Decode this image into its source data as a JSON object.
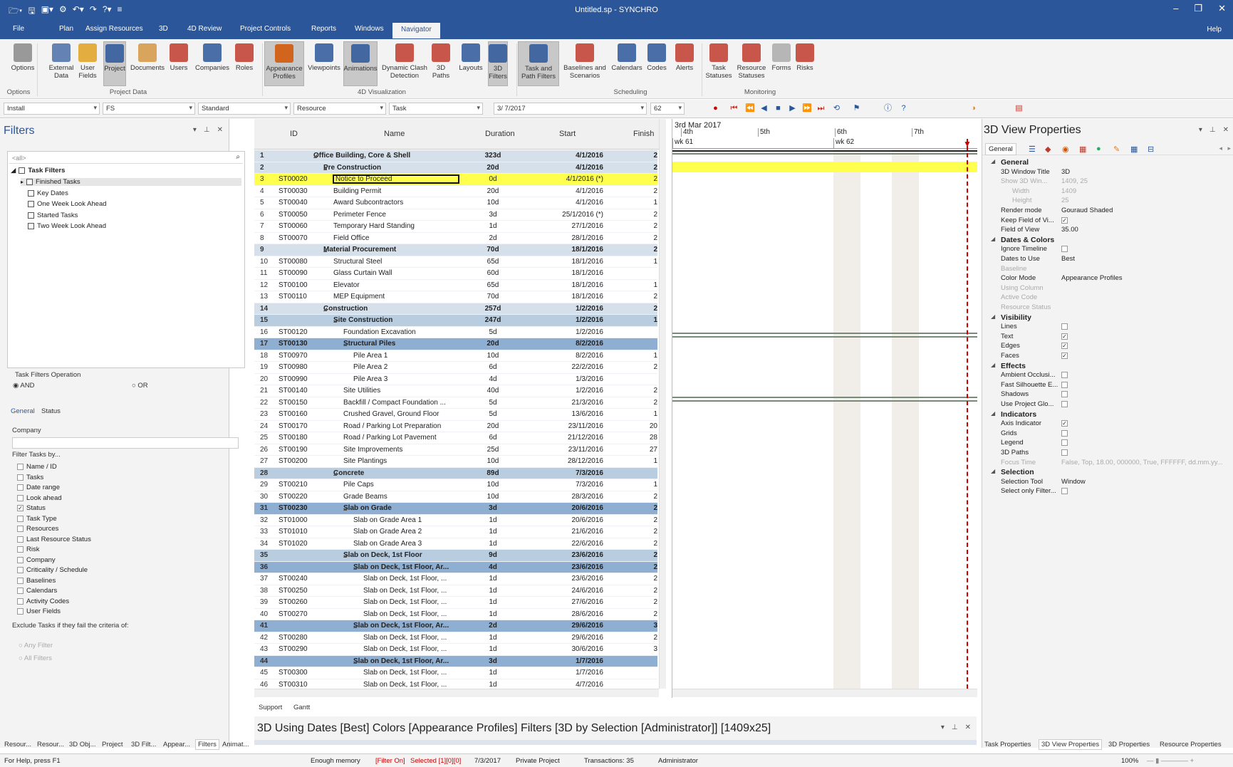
{
  "window": {
    "title": "Untitled.sp - SYNCHRO"
  },
  "tabs": [
    "File",
    "Plan",
    "Assign Resources",
    "3D",
    "4D Review",
    "Project Controls",
    "Reports",
    "Windows",
    "Navigator"
  ],
  "active_tab": "Navigator",
  "help": "Help",
  "ribbon": {
    "buttons": [
      {
        "label": "Options",
        "icon": "gear-icon"
      },
      {
        "label": "External Data",
        "icon": "network-icon"
      },
      {
        "label": "User Fields",
        "icon": "braces-icon"
      },
      {
        "label": "Project",
        "icon": "project-icon"
      },
      {
        "label": "Documents",
        "icon": "document-icon"
      },
      {
        "label": "Users",
        "icon": "user-icon"
      },
      {
        "label": "Companies",
        "icon": "building-icon"
      },
      {
        "label": "Roles",
        "icon": "role-icon"
      },
      {
        "label": "Appearance Profiles",
        "icon": "appearance-icon"
      },
      {
        "label": "Viewpoints",
        "icon": "viewpoint-icon"
      },
      {
        "label": "Animations",
        "icon": "film-icon"
      },
      {
        "label": "Dynamic Clash Detection",
        "icon": "clash-icon"
      },
      {
        "label": "3D Paths",
        "icon": "path-icon"
      },
      {
        "label": "Layouts",
        "icon": "layout-icon"
      },
      {
        "label": "3D Filters",
        "icon": "cube-filter-icon"
      },
      {
        "label": "Task and Path Filters",
        "icon": "funnel-icon"
      },
      {
        "label": "Baselines and Scenarios",
        "icon": "baseline-icon"
      },
      {
        "label": "Calendars",
        "icon": "calendar-icon"
      },
      {
        "label": "Codes",
        "icon": "codes-icon"
      },
      {
        "label": "Alerts",
        "icon": "alert-icon"
      },
      {
        "label": "Task Statuses",
        "icon": "task-status-icon"
      },
      {
        "label": "Resource Statuses",
        "icon": "resource-status-icon"
      },
      {
        "label": "Forms",
        "icon": "form-icon"
      },
      {
        "label": "Risks",
        "icon": "risk-icon"
      }
    ],
    "groups": [
      "Options",
      "Project Data",
      "4D Visualization",
      "Scheduling",
      "Monitoring"
    ]
  },
  "toolbar": {
    "combo1": "Install",
    "combo2": "FS",
    "combo3": "Standard",
    "combo4": "Resource",
    "combo5": "Task",
    "date": "3/ 7/2017",
    "zoom": "62"
  },
  "filters": {
    "title": "Filters",
    "search_placeholder": "<all>",
    "root": "Task Filters",
    "items": [
      "Finished Tasks",
      "Key Dates",
      "One Week Look Ahead",
      "Started Tasks",
      "Two Week Look Ahead"
    ],
    "operation_label": "Task Filters Operation",
    "op_and": "AND",
    "op_or": "OR",
    "subtabs": [
      "General",
      "Status"
    ],
    "company_label": "Company",
    "filter_by_label": "Filter Tasks by...",
    "filter_by": [
      "Name / ID",
      "Tasks",
      "Date range",
      "Look ahead",
      "Status",
      "Task Type",
      "Resources",
      "Last Resource Status",
      "Risk",
      "Company",
      "Criticality / Schedule",
      "Baselines",
      "Calendars",
      "Activity Codes",
      "User Fields"
    ],
    "exclude_label": "Exclude Tasks if they fail the criteria of:",
    "any_filter": "Any Filter",
    "all_filters": "All Filters"
  },
  "grid": {
    "headers": {
      "id": "ID",
      "name": "Name",
      "duration": "Duration",
      "start": "Start",
      "finish": "Finish"
    },
    "rows": [
      {
        "n": "1",
        "id": "",
        "name": "Office Building, Core & Shell",
        "dur": "323d",
        "start": "4/1/2016",
        "fin": "2",
        "lvl": 0,
        "type": "sum1"
      },
      {
        "n": "2",
        "id": "",
        "name": "Pre Construction",
        "dur": "20d",
        "start": "4/1/2016",
        "fin": "2",
        "lvl": 1,
        "type": "sum1"
      },
      {
        "n": "3",
        "id": "ST00020",
        "name": "Notice to Proceed",
        "dur": "0d",
        "start": "4/1/2016 (*)",
        "fin": "2",
        "lvl": 2,
        "type": "sel"
      },
      {
        "n": "4",
        "id": "ST00030",
        "name": "Building Permit",
        "dur": "20d",
        "start": "4/1/2016",
        "fin": "2",
        "lvl": 2,
        "type": ""
      },
      {
        "n": "5",
        "id": "ST00040",
        "name": "Award Subcontractors",
        "dur": "10d",
        "start": "4/1/2016",
        "fin": "1",
        "lvl": 2,
        "type": ""
      },
      {
        "n": "6",
        "id": "ST00050",
        "name": "Perimeter Fence",
        "dur": "3d",
        "start": "25/1/2016 (*)",
        "fin": "2",
        "lvl": 2,
        "type": ""
      },
      {
        "n": "7",
        "id": "ST00060",
        "name": "Temporary Hard Standing",
        "dur": "1d",
        "start": "27/1/2016",
        "fin": "2",
        "lvl": 2,
        "type": ""
      },
      {
        "n": "8",
        "id": "ST00070",
        "name": "Field Office",
        "dur": "2d",
        "start": "28/1/2016",
        "fin": "2",
        "lvl": 2,
        "type": ""
      },
      {
        "n": "9",
        "id": "",
        "name": "Material Procurement",
        "dur": "70d",
        "start": "18/1/2016",
        "fin": "2",
        "lvl": 1,
        "type": "sum1"
      },
      {
        "n": "10",
        "id": "ST00080",
        "name": "Structural Steel",
        "dur": "65d",
        "start": "18/1/2016",
        "fin": "1",
        "lvl": 2,
        "type": ""
      },
      {
        "n": "11",
        "id": "ST00090",
        "name": "Glass Curtain Wall",
        "dur": "60d",
        "start": "18/1/2016",
        "fin": "",
        "lvl": 2,
        "type": ""
      },
      {
        "n": "12",
        "id": "ST00100",
        "name": "Elevator",
        "dur": "65d",
        "start": "18/1/2016",
        "fin": "1",
        "lvl": 2,
        "type": ""
      },
      {
        "n": "13",
        "id": "ST00110",
        "name": "MEP Equipment",
        "dur": "70d",
        "start": "18/1/2016",
        "fin": "2",
        "lvl": 2,
        "type": ""
      },
      {
        "n": "14",
        "id": "",
        "name": "Construction",
        "dur": "257d",
        "start": "1/2/2016",
        "fin": "2",
        "lvl": 1,
        "type": "sum1"
      },
      {
        "n": "15",
        "id": "",
        "name": "Site Construction",
        "dur": "247d",
        "start": "1/2/2016",
        "fin": "1",
        "lvl": 2,
        "type": "sum2"
      },
      {
        "n": "16",
        "id": "ST00120",
        "name": "Foundation Excavation",
        "dur": "5d",
        "start": "1/2/2016",
        "fin": "",
        "lvl": 3,
        "type": ""
      },
      {
        "n": "17",
        "id": "ST00130",
        "name": "Structural Piles",
        "dur": "20d",
        "start": "8/2/2016",
        "fin": "",
        "lvl": 3,
        "type": "sum3"
      },
      {
        "n": "18",
        "id": "ST00970",
        "name": "Pile Area 1",
        "dur": "10d",
        "start": "8/2/2016",
        "fin": "1",
        "lvl": 4,
        "type": ""
      },
      {
        "n": "19",
        "id": "ST00980",
        "name": "Pile Area 2",
        "dur": "6d",
        "start": "22/2/2016",
        "fin": "2",
        "lvl": 4,
        "type": ""
      },
      {
        "n": "20",
        "id": "ST00990",
        "name": "Pile Area 3",
        "dur": "4d",
        "start": "1/3/2016",
        "fin": "",
        "lvl": 4,
        "type": ""
      },
      {
        "n": "21",
        "id": "ST00140",
        "name": "Site Utilities",
        "dur": "40d",
        "start": "1/2/2016",
        "fin": "2",
        "lvl": 3,
        "type": ""
      },
      {
        "n": "22",
        "id": "ST00150",
        "name": "Backfill / Compact  Foundation ...",
        "dur": "5d",
        "start": "21/3/2016",
        "fin": "2",
        "lvl": 3,
        "type": ""
      },
      {
        "n": "23",
        "id": "ST00160",
        "name": "Crushed Gravel, Ground Floor",
        "dur": "5d",
        "start": "13/6/2016",
        "fin": "1",
        "lvl": 3,
        "type": ""
      },
      {
        "n": "24",
        "id": "ST00170",
        "name": "Road / Parking Lot Preparation",
        "dur": "20d",
        "start": "23/11/2016",
        "fin": "20",
        "lvl": 3,
        "type": ""
      },
      {
        "n": "25",
        "id": "ST00180",
        "name": "Road / Parking Lot Pavement",
        "dur": "6d",
        "start": "21/12/2016",
        "fin": "28",
        "lvl": 3,
        "type": ""
      },
      {
        "n": "26",
        "id": "ST00190",
        "name": "Site Improvements",
        "dur": "25d",
        "start": "23/11/2016",
        "fin": "27",
        "lvl": 3,
        "type": ""
      },
      {
        "n": "27",
        "id": "ST00200",
        "name": "Site Plantings",
        "dur": "10d",
        "start": "28/12/2016",
        "fin": "1",
        "lvl": 3,
        "type": ""
      },
      {
        "n": "28",
        "id": "",
        "name": "Concrete",
        "dur": "89d",
        "start": "7/3/2016",
        "fin": "",
        "lvl": 2,
        "type": "sum2"
      },
      {
        "n": "29",
        "id": "ST00210",
        "name": "Pile Caps",
        "dur": "10d",
        "start": "7/3/2016",
        "fin": "1",
        "lvl": 3,
        "type": ""
      },
      {
        "n": "30",
        "id": "ST00220",
        "name": "Grade Beams",
        "dur": "10d",
        "start": "28/3/2016",
        "fin": "2",
        "lvl": 3,
        "type": ""
      },
      {
        "n": "31",
        "id": "ST00230",
        "name": "Slab on Grade",
        "dur": "3d",
        "start": "20/6/2016",
        "fin": "2",
        "lvl": 3,
        "type": "sum3"
      },
      {
        "n": "32",
        "id": "ST01000",
        "name": "Slab on Grade Area 1",
        "dur": "1d",
        "start": "20/6/2016",
        "fin": "2",
        "lvl": 4,
        "type": ""
      },
      {
        "n": "33",
        "id": "ST01010",
        "name": "Slab on Grade Area 2",
        "dur": "1d",
        "start": "21/6/2016",
        "fin": "2",
        "lvl": 4,
        "type": ""
      },
      {
        "n": "34",
        "id": "ST01020",
        "name": "Slab on Grade Area 3",
        "dur": "1d",
        "start": "22/6/2016",
        "fin": "2",
        "lvl": 4,
        "type": ""
      },
      {
        "n": "35",
        "id": "",
        "name": "Slab on Deck, 1st Floor",
        "dur": "9d",
        "start": "23/6/2016",
        "fin": "2",
        "lvl": 3,
        "type": "sum2"
      },
      {
        "n": "36",
        "id": "",
        "name": "Slab on Deck, 1st Floor, Ar...",
        "dur": "4d",
        "start": "23/6/2016",
        "fin": "2",
        "lvl": 4,
        "type": "sum3"
      },
      {
        "n": "37",
        "id": "ST00240",
        "name": "Slab on Deck, 1st Floor, ...",
        "dur": "1d",
        "start": "23/6/2016",
        "fin": "2",
        "lvl": 5,
        "type": ""
      },
      {
        "n": "38",
        "id": "ST00250",
        "name": "Slab on Deck, 1st Floor, ...",
        "dur": "1d",
        "start": "24/6/2016",
        "fin": "2",
        "lvl": 5,
        "type": ""
      },
      {
        "n": "39",
        "id": "ST00260",
        "name": "Slab on Deck, 1st Floor, ...",
        "dur": "1d",
        "start": "27/6/2016",
        "fin": "2",
        "lvl": 5,
        "type": ""
      },
      {
        "n": "40",
        "id": "ST00270",
        "name": "Slab on Deck, 1st Floor, ...",
        "dur": "1d",
        "start": "28/6/2016",
        "fin": "2",
        "lvl": 5,
        "type": ""
      },
      {
        "n": "41",
        "id": "",
        "name": "Slab on Deck, 1st Floor, Ar...",
        "dur": "2d",
        "start": "29/6/2016",
        "fin": "3",
        "lvl": 4,
        "type": "sum3"
      },
      {
        "n": "42",
        "id": "ST00280",
        "name": "Slab on Deck, 1st Floor, ...",
        "dur": "1d",
        "start": "29/6/2016",
        "fin": "2",
        "lvl": 5,
        "type": ""
      },
      {
        "n": "43",
        "id": "ST00290",
        "name": "Slab on Deck, 1st Floor, ...",
        "dur": "1d",
        "start": "30/6/2016",
        "fin": "3",
        "lvl": 5,
        "type": ""
      },
      {
        "n": "44",
        "id": "",
        "name": "Slab on Deck, 1st Floor, Ar...",
        "dur": "3d",
        "start": "1/7/2016",
        "fin": "",
        "lvl": 4,
        "type": "sum3"
      },
      {
        "n": "45",
        "id": "ST00300",
        "name": "Slab on Deck, 1st Floor, ...",
        "dur": "1d",
        "start": "1/7/2016",
        "fin": "",
        "lvl": 5,
        "type": ""
      },
      {
        "n": "46",
        "id": "ST00310",
        "name": "Slab on Deck, 1st Floor, ...",
        "dur": "1d",
        "start": "4/7/2016",
        "fin": "",
        "lvl": 5,
        "type": ""
      }
    ],
    "bottom_tabs": [
      "Support",
      "Gantt"
    ]
  },
  "gantt": {
    "date": "3rd Mar 2017",
    "days": [
      "4th",
      "5th",
      "6th",
      "7th"
    ],
    "weeks": [
      "wk 61",
      "wk 62"
    ]
  },
  "props": {
    "title": "3D View Properties",
    "tab": "General",
    "rows": [
      {
        "k": "General",
        "v": "",
        "t": "cat"
      },
      {
        "k": "3D Window Title",
        "v": "3D",
        "t": ""
      },
      {
        "k": "Show 3D Win...",
        "v": "1409, 25",
        "t": "dis"
      },
      {
        "k": "Width",
        "v": "1409",
        "t": "dis"
      },
      {
        "k": "Height",
        "v": "25",
        "t": "dis"
      },
      {
        "k": "Render mode",
        "v": "Gouraud Shaded",
        "t": ""
      },
      {
        "k": "Keep Field of Vi...",
        "v": "✓",
        "t": "cb"
      },
      {
        "k": "Field of View",
        "v": "35.00",
        "t": ""
      },
      {
        "k": "Dates & Colors",
        "v": "",
        "t": "cat"
      },
      {
        "k": "Ignore Timeline",
        "v": "",
        "t": "cb"
      },
      {
        "k": "Dates to Use",
        "v": "Best",
        "t": ""
      },
      {
        "k": "Baseline",
        "v": "",
        "t": "dis"
      },
      {
        "k": "Color Mode",
        "v": "Appearance Profiles",
        "t": ""
      },
      {
        "k": "Using Column",
        "v": "",
        "t": "dis"
      },
      {
        "k": "Active Code",
        "v": "",
        "t": "dis"
      },
      {
        "k": "Resource Status",
        "v": "",
        "t": "dis"
      },
      {
        "k": "Visibility",
        "v": "",
        "t": "cat"
      },
      {
        "k": "Lines",
        "v": "",
        "t": "cb"
      },
      {
        "k": "Text",
        "v": "✓",
        "t": "cb"
      },
      {
        "k": "Edges",
        "v": "✓",
        "t": "cb"
      },
      {
        "k": "Faces",
        "v": "✓",
        "t": "cb"
      },
      {
        "k": "Effects",
        "v": "",
        "t": "cat"
      },
      {
        "k": "Ambient Occlusi...",
        "v": "",
        "t": "cb"
      },
      {
        "k": "Fast Silhouette E...",
        "v": "",
        "t": "cb"
      },
      {
        "k": "Shadows",
        "v": "",
        "t": "cb"
      },
      {
        "k": "Use Project Glo...",
        "v": "",
        "t": "cb"
      },
      {
        "k": "Indicators",
        "v": "",
        "t": "cat"
      },
      {
        "k": "Axis Indicator",
        "v": "✓",
        "t": "cb"
      },
      {
        "k": "Grids",
        "v": "",
        "t": "cb"
      },
      {
        "k": "Legend",
        "v": "",
        "t": "cb"
      },
      {
        "k": "3D Paths",
        "v": "",
        "t": "cb"
      },
      {
        "k": "Focus Time",
        "v": "False, Top, 18.00, 000000, True, FFFFFF, dd.mm.yy...",
        "t": "dis"
      },
      {
        "k": "Selection",
        "v": "",
        "t": "cat"
      },
      {
        "k": "Selection Tool",
        "v": "Window",
        "t": ""
      },
      {
        "k": "Select only Filter...",
        "v": "",
        "t": "cb"
      }
    ]
  },
  "bottom_pane": {
    "text": "3D Using Dates [Best] Colors [Appearance Profiles] Filters [3D by Selection [Administrator]]   [1409x25]"
  },
  "left_tabs": [
    "Resour...",
    "Resour...",
    "3D Obj...",
    "Project",
    "3D Filt...",
    "Appear...",
    "Filters",
    "Animat..."
  ],
  "right_tabs": [
    "Task Properties",
    "3D View Properties",
    "3D Properties",
    "Resource Properties"
  ],
  "status": {
    "help": "For Help, press F1",
    "memory": "Enough memory",
    "filter": "[Filter On]",
    "selected": "Selected [1][0][0]",
    "date": "7/3/2017",
    "project": "Private Project",
    "transactions": "Transactions: 35",
    "user": "Administrator",
    "zoom": "100%"
  },
  "colors": {
    "accent": "#2b579a",
    "selected_row": "#ffff4d",
    "summary1": "#d6e0ea",
    "summary2": "#b9cde0",
    "summary3": "#8eaed2"
  }
}
